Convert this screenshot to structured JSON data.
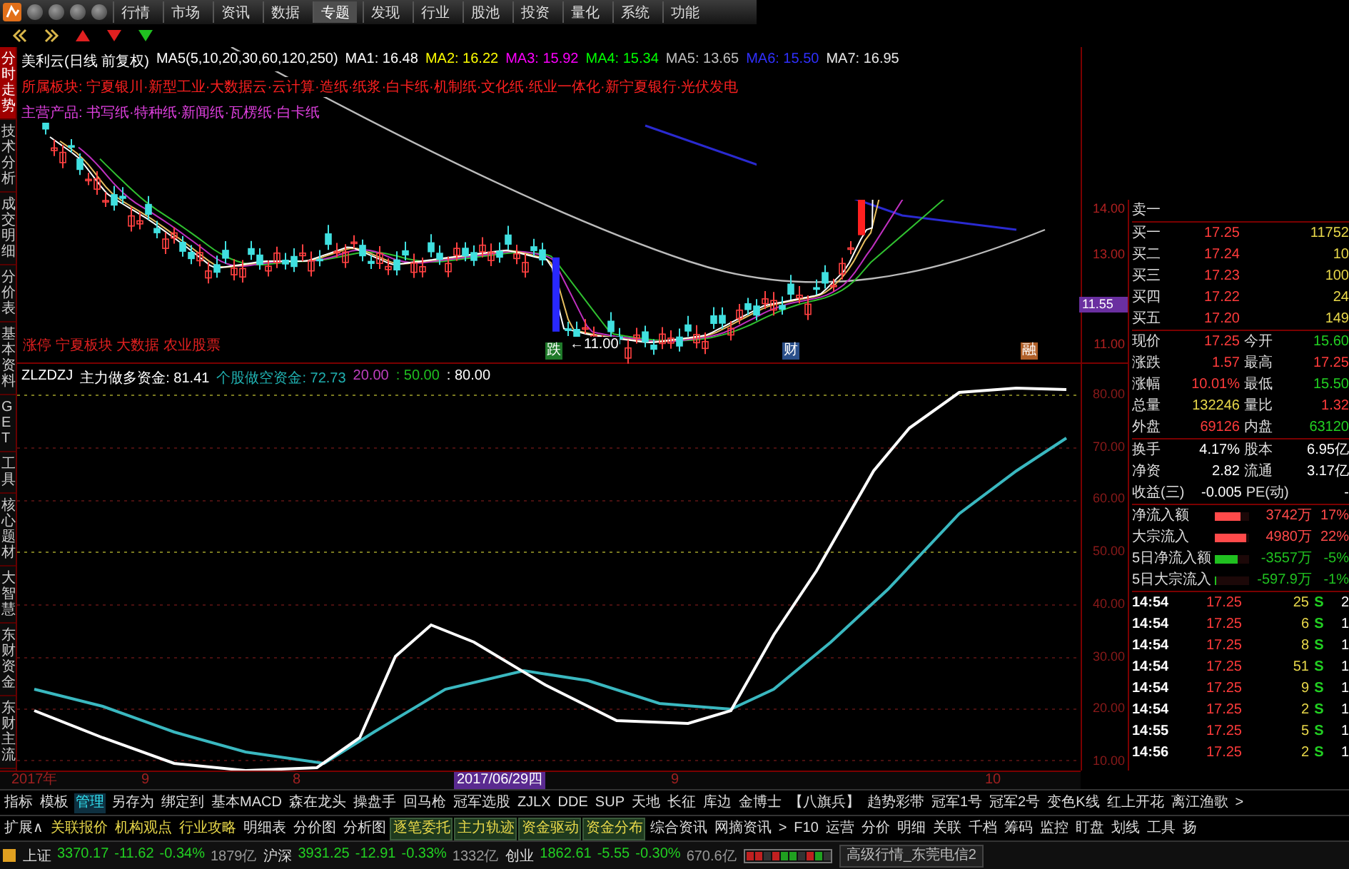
{
  "menu": {
    "items": [
      {
        "label": "行情",
        "selected": false
      },
      {
        "label": "市场",
        "selected": false
      },
      {
        "label": "资讯",
        "selected": false
      },
      {
        "label": "数据",
        "selected": false
      },
      {
        "label": "专题",
        "selected": true
      },
      {
        "label": "发现",
        "selected": false
      },
      {
        "label": "行业",
        "selected": false
      },
      {
        "label": "股池",
        "selected": false
      },
      {
        "label": "投资",
        "selected": false
      },
      {
        "label": "量化",
        "selected": false
      },
      {
        "label": "系统",
        "selected": false
      },
      {
        "label": "功能",
        "selected": false
      }
    ]
  },
  "side_tabs": [
    {
      "label": "分时走势",
      "selected": true
    },
    {
      "label": "技术分析",
      "selected": false
    },
    {
      "label": "成交明细",
      "selected": false
    },
    {
      "label": "分价表",
      "selected": false
    },
    {
      "label": "基本资料",
      "selected": false
    },
    {
      "label": "GET",
      "selected": false
    },
    {
      "label": "工具",
      "selected": false
    },
    {
      "label": "核心题材",
      "selected": false
    },
    {
      "label": "大智慧",
      "selected": false
    },
    {
      "label": "东财资金",
      "selected": false
    },
    {
      "label": "东财主流",
      "selected": false
    }
  ],
  "kline": {
    "title": "美利云(日线 前复权)",
    "ma_params": "MA5(5,10,20,30,60,120,250)",
    "ma_values": [
      {
        "text": "MA1: 16.48",
        "color": "#ffffff"
      },
      {
        "text": "MA2: 16.22",
        "color": "#ffff00"
      },
      {
        "text": "MA3: 15.92",
        "color": "#ff00ff"
      },
      {
        "text": "MA4: 15.34",
        "color": "#00ff00"
      },
      {
        "text": "MA5: 13.65",
        "color": "#c0c0c0"
      },
      {
        "text": "MA6: 15.50",
        "color": "#3030ff"
      },
      {
        "text": "MA7: 16.95",
        "color": "#e8e8e8"
      }
    ],
    "sectors": "所属板块: 宁夏银川·新型工业·大数据云·云计算·造纸·纸浆·白卡纸·机制纸·文化纸·纸业一体化·新宁夏银行·光伏发电",
    "products": "主营产品: 书写纸·特种纸·新闻纸·瓦楞纸·白卡纸",
    "price_labels": [
      {
        "text": "14.00",
        "kind": "tick"
      },
      {
        "text": "13.00",
        "kind": "tick"
      },
      {
        "text": "11.55",
        "kind": "current"
      },
      {
        "text": "11.00",
        "kind": "tick"
      }
    ],
    "note": "涨停 宁夏板块 大数据 农业股票",
    "markers": [
      {
        "text": "跌",
        "kind": "box",
        "color": "#1f7a2a"
      },
      {
        "text": "←11.00",
        "kind": "label",
        "color": "#ffffff"
      },
      {
        "text": "财",
        "kind": "box",
        "color": "#2a4f8a"
      },
      {
        "text": "融",
        "kind": "box",
        "color": "#b0602a"
      }
    ]
  },
  "indicator": {
    "name": "ZLZDZJ",
    "values": [
      {
        "text": "主力做多资金: 81.41",
        "color": "#ffffff"
      },
      {
        "text": "个股做空资金: 72.73",
        "color": "#20b0b0"
      },
      {
        "text": "20.00",
        "color": "#c040c0"
      },
      {
        "text": ": 50.00",
        "color": "#20c020"
      },
      {
        "text": ": 80.00",
        "color": "#ffffff"
      }
    ],
    "axis_labels": [
      "80.00",
      "70.00",
      "60.00",
      "50.00",
      "40.00",
      "30.00",
      "20.00",
      "10.00"
    ]
  },
  "quote": {
    "ask": {
      "label": "卖一"
    },
    "bids": [
      {
        "label": "买一",
        "price": "17.25",
        "volume": "11752"
      },
      {
        "label": "买二",
        "price": "17.24",
        "volume": "10"
      },
      {
        "label": "买三",
        "price": "17.23",
        "volume": "100"
      },
      {
        "label": "买四",
        "price": "17.22",
        "volume": "24"
      },
      {
        "label": "买五",
        "price": "17.20",
        "volume": "149"
      }
    ],
    "stats": [
      {
        "left": {
          "label": "现价",
          "value": "17.25",
          "color": "#ff3b3b"
        },
        "right": {
          "label": "今开",
          "value": "15.60",
          "color": "#22d022"
        }
      },
      {
        "left": {
          "label": "涨跌",
          "value": "1.57",
          "color": "#ff3b3b"
        },
        "right": {
          "label": "最高",
          "value": "17.25",
          "color": "#ff3b3b"
        }
      },
      {
        "left": {
          "label": "涨幅",
          "value": "10.01%",
          "color": "#ff3b3b"
        },
        "right": {
          "label": "最低",
          "value": "15.50",
          "color": "#22d022"
        }
      },
      {
        "left": {
          "label": "总量",
          "value": "132246",
          "color": "#e8d84a"
        },
        "right": {
          "label": "量比",
          "value": "1.32",
          "color": "#ff3b3b"
        }
      },
      {
        "left": {
          "label": "外盘",
          "value": "69126",
          "color": "#ff3b3b"
        },
        "right": {
          "label": "内盘",
          "value": "63120",
          "color": "#22d022"
        }
      },
      {
        "left": {
          "label": "换手",
          "value": "4.17%",
          "color": "#ffffff"
        },
        "right": {
          "label": "股本",
          "value": "6.95亿",
          "color": "#ffffff"
        }
      },
      {
        "left": {
          "label": "净资",
          "value": "2.82",
          "color": "#ffffff"
        },
        "right": {
          "label": "流通",
          "value": "3.17亿",
          "color": "#ffffff"
        }
      },
      {
        "left": {
          "label": "收益(三)",
          "value": "-0.005",
          "color": "#ffffff"
        },
        "right": {
          "label": "PE(动)",
          "value": "-",
          "color": "#ffffff"
        }
      }
    ],
    "flows": [
      {
        "label": "净流入额",
        "level": 0.75,
        "color": "#ff4a4a",
        "amount": "3742万",
        "pct": "17%"
      },
      {
        "label": "大宗流入",
        "level": 0.92,
        "color": "#ff4a4a",
        "amount": "4980万",
        "pct": "22%"
      },
      {
        "label": "5日净流入额",
        "level": 0.67,
        "color": "#20c020",
        "amount": "-3557万",
        "pct": "-5%"
      },
      {
        "label": "5日大宗流入",
        "level": 0.05,
        "color": "#20c020",
        "amount": "-597.9万",
        "pct": "-1%"
      }
    ],
    "trades": [
      {
        "time": "14:54",
        "price": "17.25",
        "volume": "25",
        "side": "S",
        "count": "2"
      },
      {
        "time": "14:54",
        "price": "17.25",
        "volume": "6",
        "side": "S",
        "count": "1"
      },
      {
        "time": "14:54",
        "price": "17.25",
        "volume": "8",
        "side": "S",
        "count": "1"
      },
      {
        "time": "14:54",
        "price": "17.25",
        "volume": "51",
        "side": "S",
        "count": "1"
      },
      {
        "time": "14:54",
        "price": "17.25",
        "volume": "9",
        "side": "S",
        "count": "1"
      },
      {
        "time": "14:54",
        "price": "17.25",
        "volume": "2",
        "side": "S",
        "count": "1"
      },
      {
        "time": "14:55",
        "price": "17.25",
        "volume": "5",
        "side": "S",
        "count": "1"
      },
      {
        "time": "14:56",
        "price": "17.25",
        "volume": "2",
        "side": "S",
        "count": "1"
      }
    ]
  },
  "date_axis": {
    "labels": [
      "2017年",
      "9",
      "8",
      "9",
      "10"
    ],
    "cursor": "2017/06/29四"
  },
  "formula_bar": [
    {
      "label": "指标",
      "selected": false
    },
    {
      "label": "模板",
      "selected": false
    },
    {
      "label": "管理",
      "selected": true
    },
    {
      "label": "另存为",
      "selected": false
    },
    {
      "label": "绑定到",
      "selected": false
    },
    {
      "label": "基本MACD",
      "selected": false
    },
    {
      "label": "森在龙头",
      "selected": false
    },
    {
      "label": "操盘手",
      "selected": false
    },
    {
      "label": "回马枪",
      "selected": false
    },
    {
      "label": "冠军选股",
      "selected": false
    },
    {
      "label": "ZJLX",
      "selected": false
    },
    {
      "label": "DDE",
      "selected": false
    },
    {
      "label": "SUP",
      "selected": false
    },
    {
      "label": "天地",
      "selected": false
    },
    {
      "label": "长征",
      "selected": false
    },
    {
      "label": "库边",
      "selected": false
    },
    {
      "label": "金博士",
      "selected": false
    },
    {
      "label": "【八旗兵】",
      "selected": false
    },
    {
      "label": "趋势彩带",
      "selected": false
    },
    {
      "label": "冠军1号",
      "selected": false
    },
    {
      "label": "冠军2号",
      "selected": false
    },
    {
      "label": "变色K线",
      "selected": false
    },
    {
      "label": "红上开花",
      "selected": false
    },
    {
      "label": "离江渔歌",
      "selected": false
    },
    {
      "label": ">",
      "selected": false
    }
  ],
  "ext_bar": [
    {
      "label": "扩展∧",
      "kind": "plain",
      "selected": false
    },
    {
      "label": "关联报价",
      "kind": "yellow",
      "selected": false
    },
    {
      "label": "机构观点",
      "kind": "yellow",
      "selected": false
    },
    {
      "label": "行业攻略",
      "kind": "yellow",
      "selected": false
    },
    {
      "label": "明细表",
      "kind": "plain",
      "selected": false
    },
    {
      "label": "分价图",
      "kind": "plain",
      "selected": false
    },
    {
      "label": "分析图",
      "kind": "plain",
      "selected": false
    },
    {
      "label": "逐笔委托",
      "kind": "boxed",
      "selected": false
    },
    {
      "label": "主力轨迹",
      "kind": "boxed",
      "selected": false
    },
    {
      "label": "资金驱动",
      "kind": "boxed",
      "selected": false
    },
    {
      "label": "资金分布",
      "kind": "boxed",
      "selected": false
    },
    {
      "label": "综合资讯",
      "kind": "plain",
      "selected": false
    },
    {
      "label": "网摘资讯",
      "kind": "plain",
      "selected": false
    },
    {
      "label": ">",
      "kind": "plain",
      "selected": false
    },
    {
      "label": "F10",
      "kind": "plain",
      "selected": false
    },
    {
      "label": "运营",
      "kind": "plain",
      "selected": false
    },
    {
      "label": "分价",
      "kind": "plain",
      "selected": false
    },
    {
      "label": "明细",
      "kind": "plain",
      "selected": false
    },
    {
      "label": "关联",
      "kind": "plain",
      "selected": false
    },
    {
      "label": "千档",
      "kind": "plain",
      "selected": false
    },
    {
      "label": "筹码",
      "kind": "plain",
      "selected": false
    },
    {
      "label": "监控",
      "kind": "plain",
      "selected": false
    },
    {
      "label": "盯盘",
      "kind": "plain",
      "selected": false
    },
    {
      "label": "划线",
      "kind": "plain",
      "selected": false
    },
    {
      "label": "工具",
      "kind": "plain",
      "selected": false
    },
    {
      "label": "扬",
      "kind": "plain",
      "selected": false
    }
  ],
  "status_bar": {
    "indices": [
      {
        "name": "上证",
        "value": "3370.17",
        "change": "-11.62",
        "pct": "-0.34%",
        "amount": "1879亿",
        "color": "#22d022"
      },
      {
        "name": "沪深",
        "value": "3931.25",
        "change": "-12.91",
        "pct": "-0.33%",
        "amount": "1332亿",
        "color": "#22d022"
      },
      {
        "name": "创业",
        "value": "1862.61",
        "change": "-5.55",
        "pct": "-0.30%",
        "amount": "670.6亿",
        "color": "#22d022"
      }
    ],
    "server": "高级行情_东莞电信2"
  }
}
